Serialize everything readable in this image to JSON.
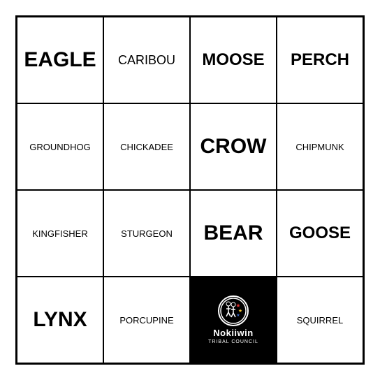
{
  "card": {
    "cells": [
      {
        "id": "r0c0",
        "text": "EAGLE",
        "size": "xl",
        "bold": true,
        "free": false
      },
      {
        "id": "r0c1",
        "text": "CARIBOU",
        "size": "md",
        "bold": false,
        "free": false
      },
      {
        "id": "r0c2",
        "text": "MOOSE",
        "size": "lg",
        "bold": true,
        "free": false
      },
      {
        "id": "r0c3",
        "text": "PERCH",
        "size": "lg",
        "bold": true,
        "free": false
      },
      {
        "id": "r1c0",
        "text": "GROUNDHOG",
        "size": "sm",
        "bold": false,
        "free": false
      },
      {
        "id": "r1c1",
        "text": "CHICKADEE",
        "size": "sm",
        "bold": false,
        "free": false
      },
      {
        "id": "r1c2",
        "text": "CROW",
        "size": "xl",
        "bold": true,
        "free": false
      },
      {
        "id": "r1c3",
        "text": "CHIPMUNK",
        "size": "sm",
        "bold": false,
        "free": false
      },
      {
        "id": "r2c0",
        "text": "KINGFISHER",
        "size": "sm",
        "bold": false,
        "free": false
      },
      {
        "id": "r2c1",
        "text": "STURGEON",
        "size": "sm",
        "bold": false,
        "free": false
      },
      {
        "id": "r2c2",
        "text": "BEAR",
        "size": "xl",
        "bold": true,
        "free": false
      },
      {
        "id": "r2c3",
        "text": "GOOSE",
        "size": "lg",
        "bold": true,
        "free": false
      },
      {
        "id": "r3c0",
        "text": "LYNX",
        "size": "xl",
        "bold": true,
        "free": false
      },
      {
        "id": "r3c1",
        "text": "PORCUPINE",
        "size": "sm",
        "bold": false,
        "free": false
      },
      {
        "id": "r3c2",
        "text": "",
        "size": "md",
        "bold": false,
        "free": true
      },
      {
        "id": "r3c3",
        "text": "SQUIRREL",
        "size": "sm",
        "bold": false,
        "free": false
      }
    ]
  }
}
